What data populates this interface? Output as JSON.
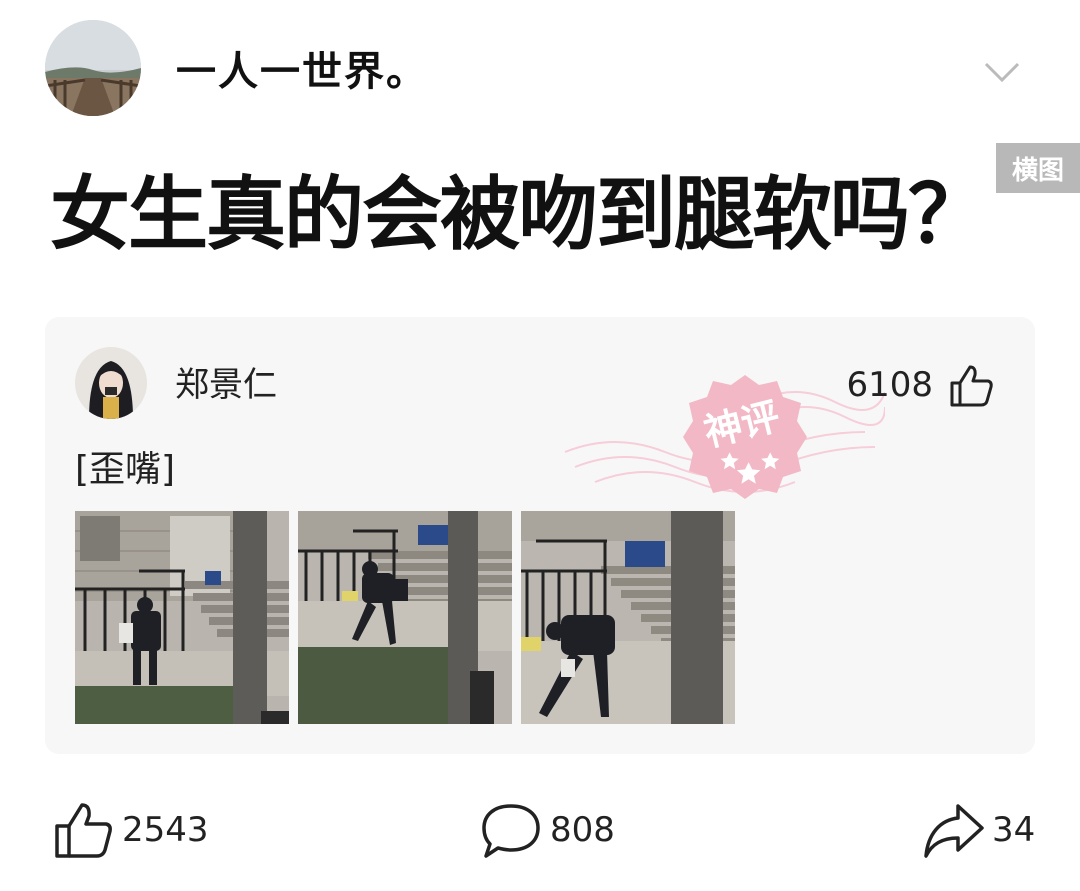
{
  "post": {
    "author_name": "一人一世界。",
    "title": "女生真的会被吻到腿软吗？",
    "image_badge": "横图"
  },
  "top_comment": {
    "user_name": "郑景仁",
    "like_count": "6108",
    "badge_text": "神评",
    "text": "[歪嘴]",
    "photo_count": 3
  },
  "actions": {
    "like_count": "2543",
    "comment_count": "808",
    "share_count": "34"
  },
  "icons": [
    "chevron-down-icon",
    "thumbs-up-icon",
    "comment-bubble-icon",
    "share-arrow-icon"
  ],
  "colors": {
    "stamp_pink": "#f2b8c6",
    "card_bg": "#f7f7f7"
  }
}
